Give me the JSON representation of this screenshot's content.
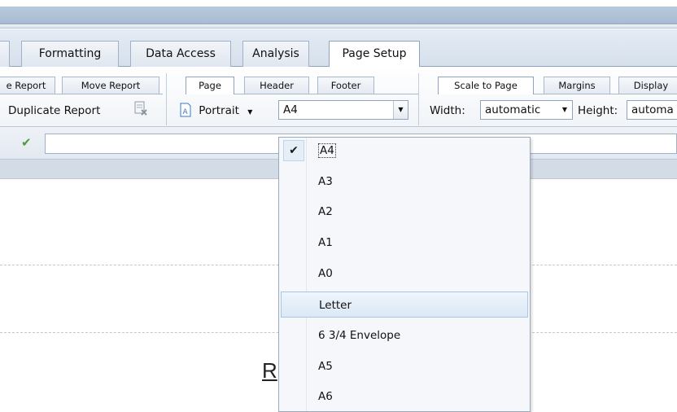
{
  "main_tabs": [
    {
      "label": ""
    },
    {
      "label": "Formatting"
    },
    {
      "label": "Data Access"
    },
    {
      "label": "Analysis"
    },
    {
      "label": "Page Setup"
    }
  ],
  "sub_tabs": {
    "report": [
      "e Report",
      "Move Report"
    ],
    "page": [
      "Page",
      "Header",
      "Footer"
    ],
    "scale": [
      "Scale to Page",
      "Margins",
      "Display"
    ]
  },
  "toolbar": {
    "duplicate_report": "Duplicate Report",
    "orientation": "Portrait",
    "paper_size": "A4",
    "width_label": "Width:",
    "width_value": "automatic",
    "height_label": "Height:",
    "height_value": "automa"
  },
  "formula_bar": {
    "value": ""
  },
  "canvas": {
    "report_title_partial": "R"
  },
  "paper_menu": {
    "items": [
      "A4",
      "A3",
      "A2",
      "A1",
      "A0",
      "Letter",
      "6 3/4 Envelope",
      "A5",
      "A6"
    ],
    "checked": "A4",
    "hovered": "Letter"
  },
  "colors": {
    "accent": "#8ea4bf",
    "hover": "#dbe8f6",
    "check": "#4f9a3c"
  }
}
